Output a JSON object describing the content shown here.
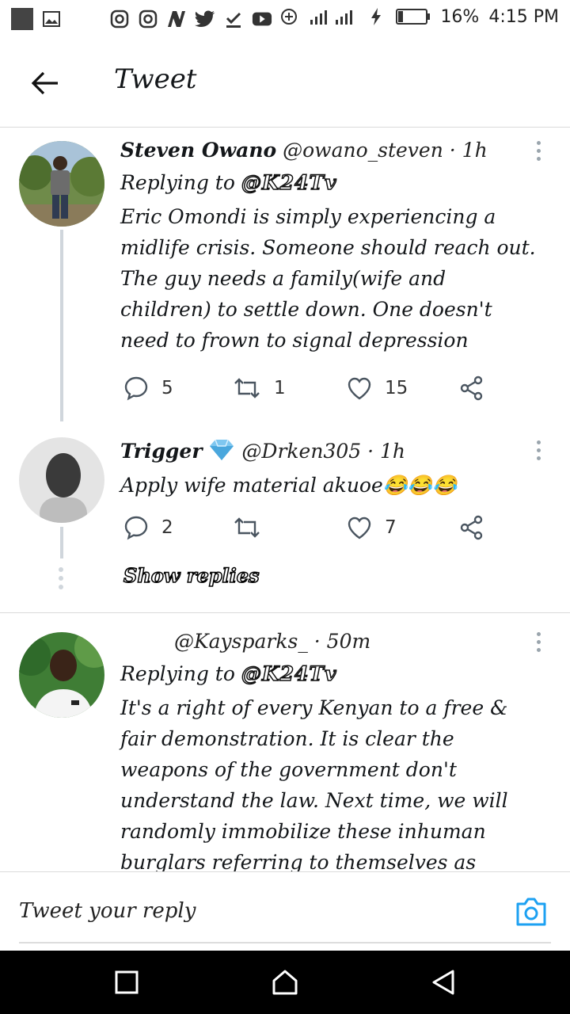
{
  "status_bar": {
    "battery": "16%",
    "time": "4:15 PM"
  },
  "header": {
    "title": "Tweet"
  },
  "tweets": [
    {
      "name": "Steven Owano",
      "handle": "@owano_steven",
      "time": "· 1h",
      "replying_prefix": "Replying to",
      "replying_to": "@K24Tv",
      "text": "Eric Omondi is simply experiencing a midlife crisis. Someone should reach out. The guy needs a family(wife and children) to settle down. One doesn't need to frown to signal depression",
      "replies": "5",
      "retweets": "1",
      "likes": "15"
    },
    {
      "name": "Trigger",
      "handle": "@Drken305",
      "time": "· 1h",
      "text": "Apply wife material akuoe😂😂😂",
      "replies": "2",
      "retweets": "",
      "likes": "7"
    },
    {
      "name": "",
      "handle": "@Kaysparks_",
      "time": "· 50m",
      "replying_prefix": "Replying to",
      "replying_to": "@K24Tv",
      "text": "It's a right of every Kenyan to a free & fair demonstration. It is clear the weapons of the government don't understand the law. Next time, we will randomly immobilize these inhuman burglars referring to themselves as police. Which police human enough"
    }
  ],
  "show_replies": "Show replies",
  "composer": {
    "placeholder": "Tweet your reply"
  },
  "colors": {
    "accent": "#1da1f2",
    "thread_line": "#d0d6dc"
  }
}
